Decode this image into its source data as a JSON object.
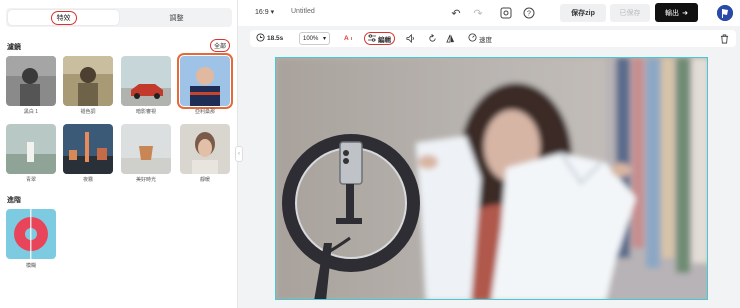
{
  "left_panel": {
    "tabs": [
      "特效",
      "調整"
    ],
    "filters_title": "濾鏡",
    "all_label": "全部",
    "filters": [
      {
        "label": "黑白 1"
      },
      {
        "label": "褪色調"
      },
      {
        "label": "暗影審視"
      },
      {
        "label": "亞利桑那"
      },
      {
        "label": "青翠"
      },
      {
        "label": "夜霧"
      },
      {
        "label": "美好時光"
      },
      {
        "label": "靜暖"
      }
    ],
    "advanced_title": "進階",
    "advanced": [
      {
        "label": "模糊"
      }
    ]
  },
  "topbar": {
    "ratio": "16:9",
    "title": "Untitled",
    "save_zip": "保存zip",
    "saved": "已保存",
    "export": "輸出"
  },
  "toolbar": {
    "duration": "18.5s",
    "zoom": "100%",
    "edit": "編輯",
    "speed": "速度"
  },
  "colors": {
    "accent_red": "#d9342b",
    "selection_orange": "#e56a3a",
    "canvas_border": "#49c7d3",
    "export_bg": "#111111"
  }
}
